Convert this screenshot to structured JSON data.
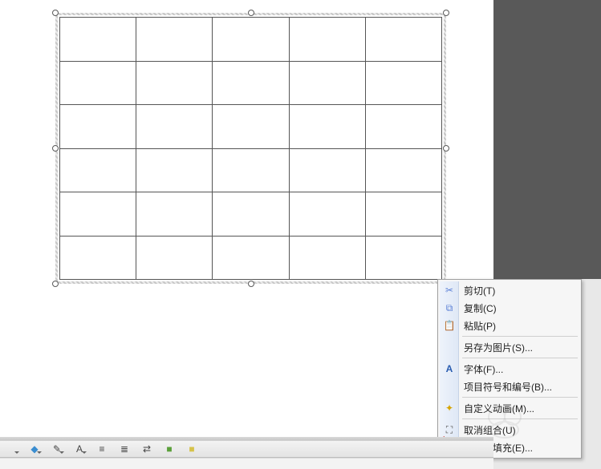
{
  "table": {
    "rows": 6,
    "cols": 5
  },
  "context_menu": [
    {
      "name": "cut",
      "label": "剪切(T)",
      "icon": "✂",
      "color": "#5a7fd6"
    },
    {
      "name": "copy",
      "label": "复制(C)",
      "icon": "⧉",
      "color": "#5a7fd6"
    },
    {
      "name": "paste",
      "label": "粘贴(P)",
      "icon": "📋",
      "color": "#c89a3a"
    },
    {
      "sep": true
    },
    {
      "name": "save-as-pic",
      "label": "另存为图片(S)...",
      "icon": ""
    },
    {
      "sep": true
    },
    {
      "name": "font",
      "label": "字体(F)...",
      "icon": "A",
      "color": "#2a5db0",
      "bold": true
    },
    {
      "name": "bullets",
      "label": "项目符号和编号(B)...",
      "icon": ""
    },
    {
      "sep": true
    },
    {
      "name": "custom-anim",
      "label": "自定义动画(M)...",
      "icon": "✦",
      "color": "#d6a400"
    },
    {
      "sep": true
    },
    {
      "name": "ungroup",
      "label": "取消组合(U)",
      "icon": "⛶",
      "color": "#555"
    },
    {
      "name": "border-fill",
      "label": "边框和填充(E)...",
      "icon": ""
    }
  ],
  "toolbar": [
    {
      "name": "picture",
      "dd": true
    },
    {
      "name": "bucket",
      "dd": true,
      "glyph": "◆",
      "color": "#3a8dd0"
    },
    {
      "name": "pen",
      "dd": true,
      "glyph": "✎"
    },
    {
      "name": "font-color",
      "dd": true,
      "glyph": "A"
    },
    {
      "name": "lines1",
      "glyph": "≡"
    },
    {
      "name": "lines2",
      "glyph": "≣"
    },
    {
      "name": "arrows",
      "glyph": "⇄"
    },
    {
      "name": "shape-green",
      "glyph": "■",
      "color": "#5aa03a"
    },
    {
      "name": "shape-yellow",
      "glyph": "■",
      "color": "#d6c24a"
    }
  ],
  "status_text": ""
}
